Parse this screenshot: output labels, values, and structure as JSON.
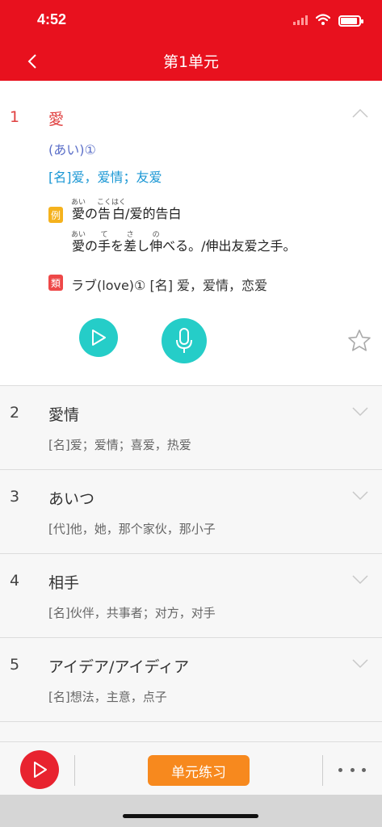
{
  "status_bar": {
    "time": "4:52"
  },
  "header": {
    "title": "第1单元"
  },
  "expanded_item": {
    "number": "1",
    "word": "愛",
    "reading": "(あい)①",
    "pos_meaning": "[名]爱，爱情；友爱",
    "example_tag": "例",
    "example1": {
      "r1_base": "愛",
      "r1_rt": "あい",
      "t1": "の",
      "r2_base": "告白",
      "r2_rt": "こくはく",
      "t2": "/爱的告白"
    },
    "example2": {
      "r1_base": "愛",
      "r1_rt": "あい",
      "t1": "の",
      "r2_base": "手",
      "r2_rt": "て",
      "t2": "を",
      "r3_base": "差",
      "r3_rt": "さ",
      "t3": "し",
      "r4_base": "伸",
      "r4_rt": "の",
      "t4": "べる。/伸出友爱之手。"
    },
    "similar_tag": "類",
    "similar": "ラブ(love)① [名] 爱，爱情，恋爱"
  },
  "items": [
    {
      "number": "2",
      "word": "愛情",
      "meaning": "[名]爱；爱情；喜爱，热爱"
    },
    {
      "number": "3",
      "word": "あいつ",
      "meaning": "[代]他，她，那个家伙，那小子"
    },
    {
      "number": "4",
      "word": "相手",
      "meaning": "[名]伙伴，共事者；对方，对手"
    },
    {
      "number": "5",
      "word": "アイデア/アイディア",
      "meaning": "[名]想法，主意，点子"
    }
  ],
  "bottom_bar": {
    "practice_label": "单元练习"
  },
  "colors": {
    "brand_red": "#e8111e",
    "teal": "#25cdc8",
    "orange": "#f7891e",
    "pos_blue": "#1a97d4"
  },
  "icons": [
    "back-icon",
    "wifi-icon",
    "battery-icon",
    "chevron-up-icon",
    "chevron-down-icon",
    "play-icon",
    "microphone-icon",
    "star-icon",
    "more-icon"
  ]
}
